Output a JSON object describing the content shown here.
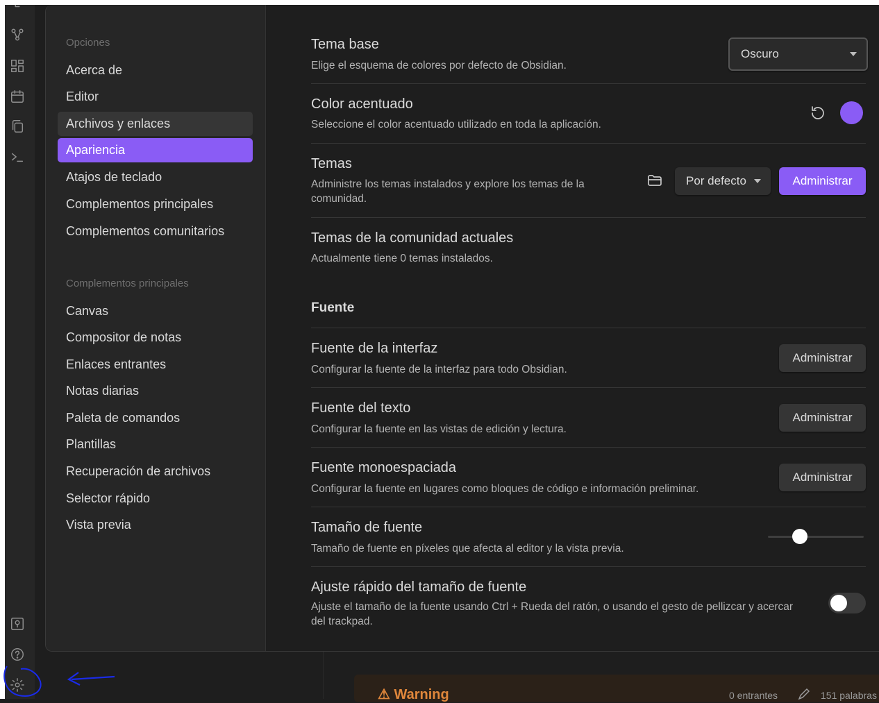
{
  "nav": {
    "group1_title": "Opciones",
    "group1_items": [
      "Acerca de",
      "Editor",
      "Archivos y enlaces",
      "Apariencia",
      "Atajos de teclado",
      "Complementos principales",
      "Complementos comunitarios"
    ],
    "group2_title": "Complementos principales",
    "group2_items": [
      "Canvas",
      "Compositor de notas",
      "Enlaces entrantes",
      "Notas diarias",
      "Paleta de comandos",
      "Plantillas",
      "Recuperación de archivos",
      "Selector rápido",
      "Vista previa"
    ],
    "hovered_item": "Archivos y enlaces",
    "active_item": "Apariencia"
  },
  "settings": {
    "base_theme": {
      "name": "Tema base",
      "desc": "Elige el esquema de colores por defecto de Obsidian.",
      "value": "Oscuro"
    },
    "accent_color": {
      "name": "Color acentuado",
      "desc": "Seleccione el color acentuado utilizado en toda la aplicación.",
      "color": "#8a5cf5"
    },
    "themes": {
      "name": "Temas",
      "desc": "Administre los temas instalados y explore los temas de la comunidad.",
      "dropdown_value": "Por defecto",
      "button": "Administrar"
    },
    "community_themes": {
      "name": "Temas de la comunidad actuales",
      "desc": "Actualmente tiene 0 temas instalados."
    },
    "font_heading": "Fuente",
    "interface_font": {
      "name": "Fuente de la interfaz",
      "desc": "Configurar la fuente de la interfaz para todo Obsidian.",
      "button": "Administrar"
    },
    "text_font": {
      "name": "Fuente del texto",
      "desc": "Configurar la fuente en las vistas de edición y lectura.",
      "button": "Administrar"
    },
    "mono_font": {
      "name": "Fuente monoespaciada",
      "desc": "Configurar la fuente en lugares como bloques de código e información preliminar.",
      "button": "Administrar"
    },
    "font_size": {
      "name": "Tamaño de fuente",
      "desc": "Tamaño de fuente en píxeles que afecta al editor y la vista previa.",
      "slider_fraction": 0.33
    },
    "quick_font_size": {
      "name": "Ajuste rápido del tamaño de fuente",
      "desc": "Ajuste el tamaño de la fuente usando Ctrl + Rueda del ratón, o usando el gesto de pellizcar y acercar del trackpad.",
      "enabled": false
    }
  },
  "background": {
    "warning": "⚠ Warning",
    "status_backlinks": "0 entrantes",
    "status_words": "151 palabras"
  },
  "ribbon_icons": [
    "graph-icon",
    "dashboard-icon",
    "calendar-icon",
    "copy-icon",
    "terminal-icon",
    "vault-icon",
    "help-icon",
    "settings-icon"
  ],
  "colors": {
    "accent": "#8a5cf5",
    "annotation": "#1a2be8"
  }
}
